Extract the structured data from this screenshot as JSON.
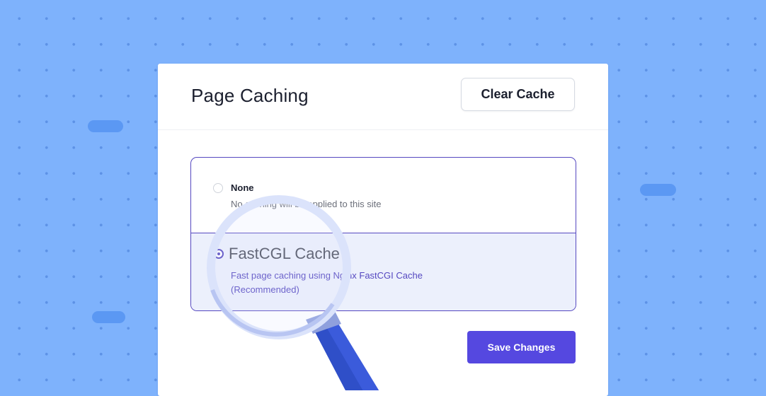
{
  "panel": {
    "title": "Page Caching",
    "clear_cache_label": "Clear Cache",
    "save_label": "Save Changes"
  },
  "options": [
    {
      "label": "None",
      "description": "No caching will be applied to this site",
      "selected": false
    },
    {
      "label": "FastCGL Cache",
      "description": "Fast page caching using Nginx FastCGI Cache",
      "note": "(Recommended)",
      "selected": true
    }
  ],
  "colors": {
    "background": "#7eb2fc",
    "accent": "#5548e0",
    "selected_bg": "#ecf0fc",
    "magnifier_handle": "#3b5bdb"
  },
  "icons": [
    "magnifying-glass-icon",
    "radio-icon"
  ]
}
